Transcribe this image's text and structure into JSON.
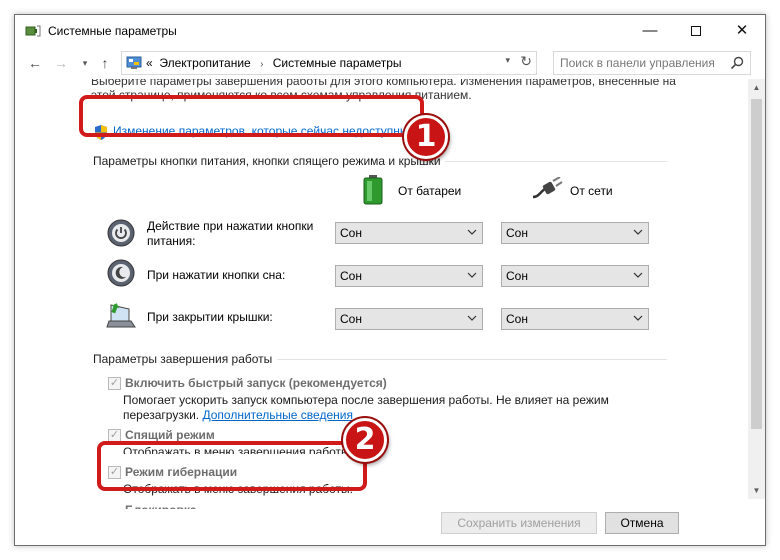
{
  "window": {
    "title": "Системные параметры"
  },
  "titlebar": {
    "minimize_glyph": "—",
    "close_glyph": "✕"
  },
  "nav": {
    "back_glyph": "←",
    "forward_glyph": "→",
    "dropdown_glyph": "▾",
    "up_glyph": "↑"
  },
  "address": {
    "prefix": "«",
    "crumbs": [
      "Электропитание",
      "Системные параметры"
    ],
    "separator": "›",
    "dropdown_glyph": "▾",
    "refresh_glyph": "↻"
  },
  "search": {
    "placeholder": "Поиск в панели управления"
  },
  "content": {
    "clipped_intro_line1": "Выберите параметры завершения работы для этого компьютера. Изменения параметров, внесенные на",
    "clipped_intro_line2": "этой странице, применяются ко всем схемам управления питанием.",
    "change_link": "Изменение параметров, которые сейчас недоступны",
    "group_buttons": "Параметры кнопки питания, кнопки спящего режима и крышки",
    "col_battery": "От батареи",
    "col_ac": "От сети",
    "rows": [
      {
        "label": "Действие при нажатии кнопки питания:",
        "battery": "Сон",
        "ac": "Сон",
        "icon": "power-button-icon"
      },
      {
        "label": "При нажатии кнопки сна:",
        "battery": "Сон",
        "ac": "Сон",
        "icon": "sleep-button-icon"
      },
      {
        "label": "При закрытии крышки:",
        "battery": "Сон",
        "ac": "Сон",
        "icon": "laptop-lid-icon"
      }
    ],
    "group_shutdown": "Параметры завершения работы",
    "fast_startup": {
      "label": "Включить быстрый запуск (рекомендуется)",
      "desc_line1": "Помогает ускорить запуск компьютера после завершения работы. Не влияет на режим",
      "desc_line2_prefix": "перезагрузки.",
      "desc_link": "Дополнительные сведения",
      "checked": true
    },
    "sleep": {
      "label": "Спящий режим",
      "desc": "Отображать в меню завершения работы.",
      "checked": true
    },
    "hibernate": {
      "label": "Режим гибернации",
      "desc": "Отображать в меню завершения работы.",
      "checked": true
    },
    "lock_clipped": "Блокировка"
  },
  "callouts": {
    "one": "1",
    "two": "2",
    "color": "#d11a1a"
  },
  "footer": {
    "save": "Сохранить изменения",
    "cancel": "Отмена"
  },
  "scrollbar": {
    "up_glyph": "▲",
    "down_glyph": "▼"
  },
  "checkbox_glyph": "✓",
  "colors": {
    "link": "#0066cc",
    "callout_red": "#d11a1a",
    "battery_green": "#3cb43c"
  }
}
